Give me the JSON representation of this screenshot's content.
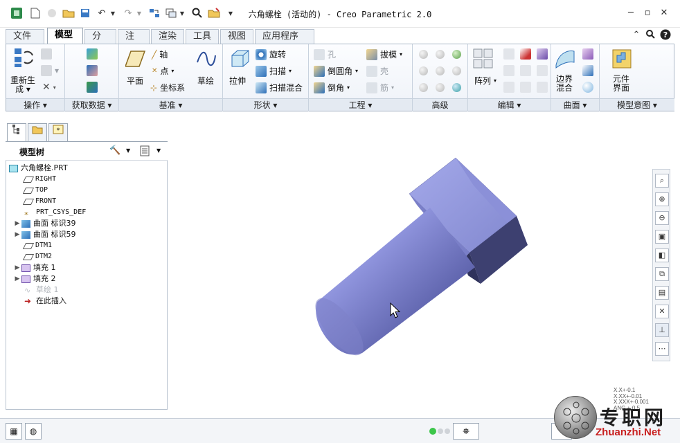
{
  "window": {
    "title": "六角螺栓 (活动的) - Creo Parametric 2.0"
  },
  "tabs": [
    "文件",
    "模型",
    "分析",
    "注释",
    "渲染",
    "工具",
    "视图",
    "应用程序"
  ],
  "ribbon": {
    "groups": [
      "操作",
      "获取数据",
      "基准",
      "形状",
      "工程",
      "高级",
      "编辑",
      "曲面",
      "模型意图"
    ],
    "regenerate_line1": "重新生",
    "regenerate_line2": "成",
    "plane": "平面",
    "axis": "轴",
    "point": "点",
    "csys": "坐标系",
    "sketch": "草绘",
    "extrude": "拉伸",
    "revolve": "旋转",
    "sweep": "扫描",
    "swept_blend": "扫描混合",
    "hole": "孔",
    "draft": "拔模",
    "round": "倒圆角",
    "shell": "壳",
    "chamfer": "倒角",
    "rib": "筋",
    "pattern": "阵列",
    "boundary_line1": "边界",
    "boundary_line2": "混合",
    "component_line1": "元件",
    "component_line2": "界面"
  },
  "model_tree": {
    "title": "模型树",
    "items": [
      {
        "label": "六角螺栓.PRT"
      },
      {
        "label": "RIGHT"
      },
      {
        "label": "TOP"
      },
      {
        "label": "FRONT"
      },
      {
        "label": "PRT_CSYS_DEF"
      },
      {
        "label": "曲面 标识39"
      },
      {
        "label": "曲面 标识59"
      },
      {
        "label": "DTM1"
      },
      {
        "label": "DTM2"
      },
      {
        "label": "填充 1"
      },
      {
        "label": "填充 2"
      },
      {
        "label": "草绘 1"
      },
      {
        "label": "在此插入"
      }
    ]
  },
  "tolerance": {
    "line1": "X.X+-0.1",
    "line2": "X.XX+-0.01",
    "line3": "X.XXX+-0.001",
    "line4": "ANG.+-0.5"
  },
  "watermark": {
    "brand": "专职网",
    "url": "Zhuanzhi.Net"
  },
  "colors": {
    "accent": "#8b8fd8",
    "bolt_face_light": "#9fa4e6",
    "bolt_face_dark": "#3c3f6e",
    "tab_border": "#9aa6b4"
  }
}
